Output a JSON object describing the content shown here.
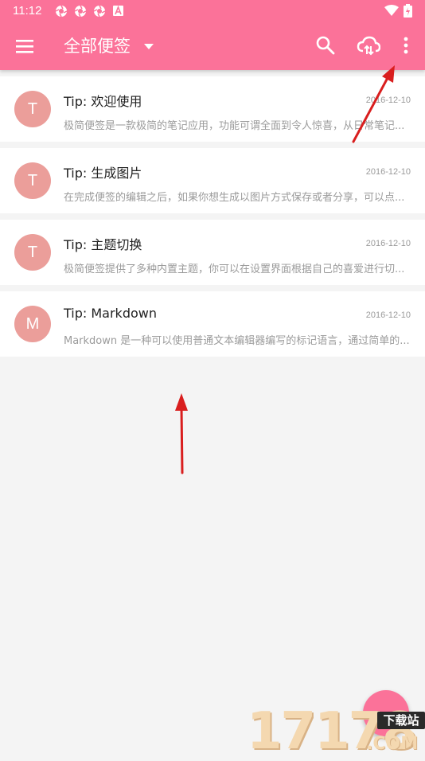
{
  "status_bar": {
    "time": "11:12",
    "notification_icons": [
      "aperture-icon",
      "aperture-icon",
      "aperture-icon",
      "a-box-icon"
    ],
    "right_icons": [
      "wifi-icon",
      "battery-icon"
    ]
  },
  "app_bar": {
    "title": "全部便签",
    "actions": [
      "search-icon",
      "cloud-sync-icon",
      "more-vert-icon"
    ],
    "background": "#fb7299"
  },
  "notes": [
    {
      "avatar": "T",
      "title": "Tip: 欢迎使用",
      "date": "2016-12-10",
      "snippet": "极简便签是一款极简的笔记应用，功能可谓全面到令人惊喜，从日常笔记..."
    },
    {
      "avatar": "T",
      "title": "Tip: 生成图片",
      "date": "2016-12-10",
      "snippet": "在完成便签的编辑之后，如果你想生成以图片方式保存或者分享，可以点..."
    },
    {
      "avatar": "T",
      "title": "Tip: 主题切换",
      "date": "2016-12-10",
      "snippet": "极简便签提供了多种内置主题，你可以在设置界面根据自己的喜爱进行切..."
    },
    {
      "avatar": "M",
      "title": "Tip: Markdown",
      "date": "2016-12-10",
      "snippet": "Markdown 是一种可以使用普通文本编辑器编写的标记语言，通过简单的..."
    }
  ],
  "avatar_color": "#eb9e9a",
  "watermark": {
    "digits": "17178",
    "badge": "下载站",
    "suffix": ".COM"
  }
}
